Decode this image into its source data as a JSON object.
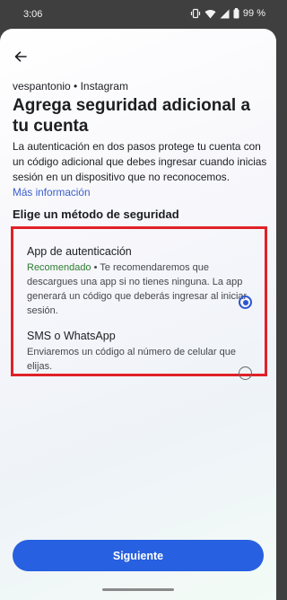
{
  "status_bar": {
    "time": "3:06",
    "battery": "99 %",
    "icons": [
      "vibrate-icon",
      "wifi-icon",
      "signal-icon",
      "battery-icon"
    ]
  },
  "header": {
    "back_icon": "arrow-left-icon",
    "account": "vespantonio • Instagram",
    "title": "Agrega seguridad adicional a tu cuenta"
  },
  "intro": {
    "text": "La autenticación en dos pasos protege tu cuenta con un código adicional que debes ingresar cuando inicias sesión en un dispositivo que no reconocemos.",
    "link": "Más información"
  },
  "methods": {
    "section_title": "Elige un método de seguridad",
    "options": [
      {
        "title": "App de autenticación",
        "recommended": "Recomendado",
        "separator": " • ",
        "description": "Te recomendaremos que descargues una app si no tienes ninguna. La app generará un código que deberás ingresar al iniciar sesión.",
        "selected": true
      },
      {
        "title": "SMS o WhatsApp",
        "description": "Enviaremos un código al número de celular que elijas.",
        "selected": false
      }
    ]
  },
  "footer": {
    "next_label": "Siguiente"
  },
  "colors": {
    "accent": "#2760e0",
    "recommended": "#2e7d32",
    "highlight": "#e02128",
    "link": "#3b5ec9"
  }
}
